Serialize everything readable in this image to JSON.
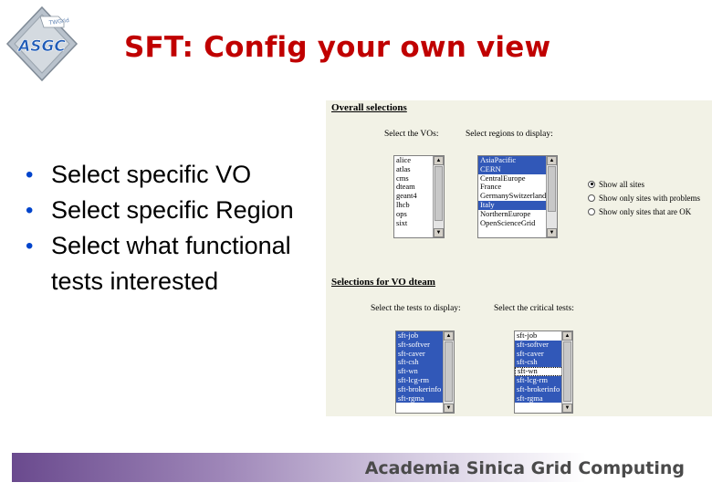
{
  "logo": {
    "text": "ASGC",
    "banner": "TWGrid",
    "colors": {
      "primary": "#1f5bb7",
      "silver": "#b9c2cc"
    }
  },
  "slide": {
    "title": "SFT: Config your own view",
    "bullets": [
      "Select specific VO",
      "Select specific Region",
      "Select what functional tests interested"
    ]
  },
  "panel": {
    "overall_title": "Overall selections",
    "vo_label": "Select the VOs:",
    "regions_label": "Select regions to display:",
    "vo_options": [
      "alice",
      "atlas",
      "cms",
      "dteam",
      "geant4",
      "lhcb",
      "ops",
      "sixt"
    ],
    "region_options": [
      {
        "label": "AsiaPacific",
        "selected": true
      },
      {
        "label": "CERN",
        "selected": true
      },
      {
        "label": "CentralEurope",
        "selected": false
      },
      {
        "label": "France",
        "selected": false
      },
      {
        "label": "GermanySwitzerland",
        "selected": false
      },
      {
        "label": "Italy",
        "selected": true
      },
      {
        "label": "NorthernEurope",
        "selected": false
      },
      {
        "label": "OpenScienceGrid",
        "selected": false
      }
    ],
    "radios": [
      {
        "label": "Show all sites",
        "checked": true
      },
      {
        "label": "Show only sites with problems",
        "checked": false
      },
      {
        "label": "Show only sites that are OK",
        "checked": false
      }
    ],
    "vo_section_title": "Selections for VO dteam",
    "tests_label": "Select the tests to display:",
    "critical_label": "Select the critical tests:",
    "test_options": [
      {
        "label": "sft-job",
        "selected": true
      },
      {
        "label": "sft-softver",
        "selected": true
      },
      {
        "label": "sft-caver",
        "selected": true
      },
      {
        "label": "sft-csh",
        "selected": true
      },
      {
        "label": "sft-wn",
        "selected": true
      },
      {
        "label": "sft-lcg-rm",
        "selected": true
      },
      {
        "label": "sft-brokerinfo",
        "selected": true
      },
      {
        "label": "sft-rgma",
        "selected": true
      }
    ],
    "critical_options": [
      {
        "label": "sft-job",
        "selected": false
      },
      {
        "label": "sft-softver",
        "selected": true
      },
      {
        "label": "sft-caver",
        "selected": true
      },
      {
        "label": "sft-csh",
        "selected": true
      },
      {
        "label": "sft-wn",
        "selected": false
      },
      {
        "label": "sft-lcg-rm",
        "selected": true
      },
      {
        "label": "sft-brokerinfo",
        "selected": true
      },
      {
        "label": "sft-rgma",
        "selected": true
      }
    ],
    "critical_focused_index": 4
  },
  "footer": {
    "text": "Academia Sinica Grid Computing"
  }
}
